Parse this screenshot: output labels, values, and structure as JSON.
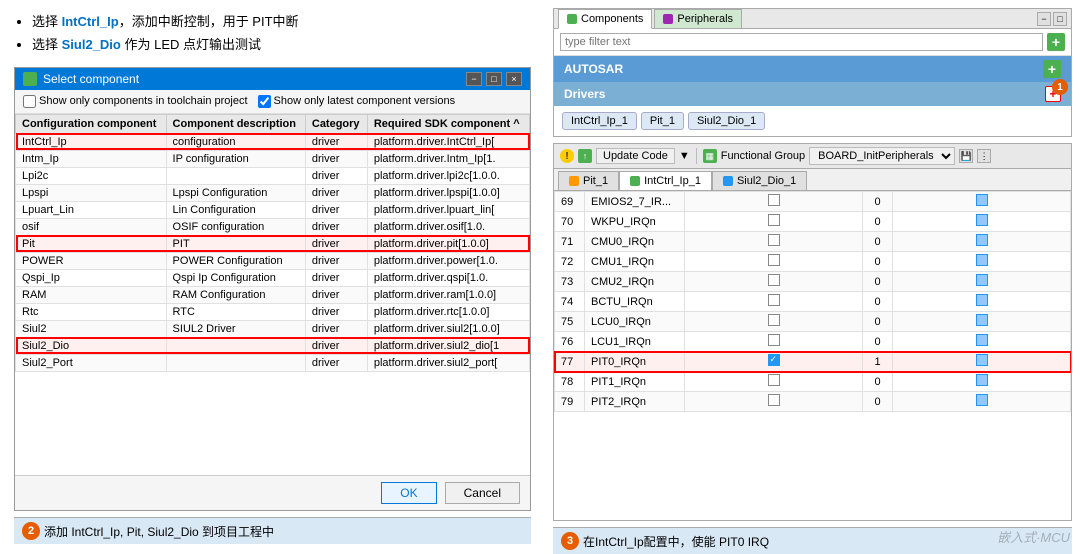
{
  "left": {
    "bullets": [
      {
        "text": "选择 IntCtrl_Ip，添加中断控制，用于 PIT中断",
        "keywords": [
          "IntCtrl_Ip"
        ]
      },
      {
        "text": "选择 Siul2_Dio 作为 LED 点灯输出测试",
        "keywords": [
          "Siul2_Dio"
        ]
      }
    ],
    "dialog": {
      "title": "Select component",
      "options": [
        {
          "label": "Show only components in toolchain project"
        },
        {
          "label": "Show only latest component versions"
        }
      ],
      "columns": [
        "Configuration component",
        "Component description",
        "Category",
        "Required SDK component"
      ],
      "rows": [
        {
          "name": "IntCtrl_Ip",
          "desc": "configuration",
          "cat": "driver",
          "sdk": "platform.driver.IntCtrl_Ip[",
          "highlighted": true
        },
        {
          "name": "Intm_Ip",
          "desc": "IP configuration",
          "cat": "driver",
          "sdk": "platform.driver.Intm_Ip[1.",
          "highlighted": false
        },
        {
          "name": "Lpi2c",
          "desc": "",
          "cat": "driver",
          "sdk": "platform.driver.lpi2c[1.0.0.",
          "highlighted": false
        },
        {
          "name": "Lpspi",
          "desc": "Lpspi Configuration",
          "cat": "driver",
          "sdk": "platform.driver.lpspi[1.0.0]",
          "highlighted": false
        },
        {
          "name": "Lpuart_Lin",
          "desc": "Lin Configuration",
          "cat": "driver",
          "sdk": "platform.driver.lpuart_lin[",
          "highlighted": false
        },
        {
          "name": "osif",
          "desc": "OSIF configuration",
          "cat": "driver",
          "sdk": "platform.driver.osif[1.0.",
          "highlighted": false
        },
        {
          "name": "Pit",
          "desc": "PIT",
          "cat": "driver",
          "sdk": "platform.driver.pit[1.0.0]",
          "highlighted": true
        },
        {
          "name": "POWER",
          "desc": "POWER Configuration",
          "cat": "driver",
          "sdk": "platform.driver.power[1.0.",
          "highlighted": false
        },
        {
          "name": "Qspi_Ip",
          "desc": "Qspi Ip Configuration",
          "cat": "driver",
          "sdk": "platform.driver.qspi[1.0.",
          "highlighted": false
        },
        {
          "name": "RAM",
          "desc": "RAM Configuration",
          "cat": "driver",
          "sdk": "platform.driver.ram[1.0.0]",
          "highlighted": false
        },
        {
          "name": "Rtc",
          "desc": "RTC",
          "cat": "driver",
          "sdk": "platform.driver.rtc[1.0.0]",
          "highlighted": false
        },
        {
          "name": "Siul2",
          "desc": "SIUL2 Driver",
          "cat": "driver",
          "sdk": "platform.driver.siul2[1.0.0]",
          "highlighted": false
        },
        {
          "name": "Siul2_Dio",
          "desc": "",
          "cat": "driver",
          "sdk": "platform.driver.siul2_dio[1",
          "highlighted": true
        },
        {
          "name": "Siul2_Port",
          "desc": "",
          "cat": "driver",
          "sdk": "platform.driver.siul2_port[",
          "highlighted": false
        }
      ],
      "ok_label": "OK",
      "cancel_label": "Cancel"
    },
    "caption": {
      "num": "2",
      "text": "添加 IntCtrl_Ip, Pit, Siul2_Dio 到项目工程中"
    }
  },
  "right": {
    "components_panel": {
      "tab1_label": "Components",
      "tab2_label": "Peripherals",
      "filter_placeholder": "type filter text",
      "autosar_label": "AUTOSAR",
      "drivers_label": "Drivers",
      "chips": [
        "IntCtrl_Ip_1",
        "Pit_1",
        "Siul2_Dio_1"
      ]
    },
    "config_panel": {
      "update_code_label": "Update Code",
      "functional_group_label": "Functional Group",
      "functional_group_value": "BOARD_InitPeripherals",
      "tabs": [
        {
          "label": "Pit_1",
          "icon": "pit"
        },
        {
          "label": "IntCtrl_Ip_1",
          "icon": "int",
          "active": true
        },
        {
          "label": "Siul2_Dio_1",
          "icon": "siul"
        }
      ],
      "irq_rows": [
        {
          "num": 69,
          "name": "EMIOS2_7_IR...",
          "checked": false,
          "value": 0,
          "enabled": true
        },
        {
          "num": 70,
          "name": "WKPU_IRQn",
          "checked": false,
          "value": 0,
          "enabled": true
        },
        {
          "num": 71,
          "name": "CMU0_IRQn",
          "checked": false,
          "value": 0,
          "enabled": true
        },
        {
          "num": 72,
          "name": "CMU1_IRQn",
          "checked": false,
          "value": 0,
          "enabled": true
        },
        {
          "num": 73,
          "name": "CMU2_IRQn",
          "checked": false,
          "value": 0,
          "enabled": true
        },
        {
          "num": 74,
          "name": "BCTU_IRQn",
          "checked": false,
          "value": 0,
          "enabled": true
        },
        {
          "num": 75,
          "name": "LCU0_IRQn",
          "checked": false,
          "value": 0,
          "enabled": true
        },
        {
          "num": 76,
          "name": "LCU1_IRQn",
          "checked": false,
          "value": 0,
          "enabled": true
        },
        {
          "num": 77,
          "name": "PIT0_IRQn",
          "checked": true,
          "value": 1,
          "enabled": true,
          "highlighted": true
        },
        {
          "num": 78,
          "name": "PIT1_IRQn",
          "checked": false,
          "value": 0,
          "enabled": true
        },
        {
          "num": 79,
          "name": "PIT2_IRQn",
          "checked": false,
          "value": 0,
          "enabled": true
        }
      ]
    },
    "caption": {
      "num": "3",
      "text": "在IntCtrl_Ip配置中，使能 PIT0 IRQ"
    },
    "watermark": "嵌入式·MCU"
  },
  "badge2": "2",
  "badge3": "3"
}
